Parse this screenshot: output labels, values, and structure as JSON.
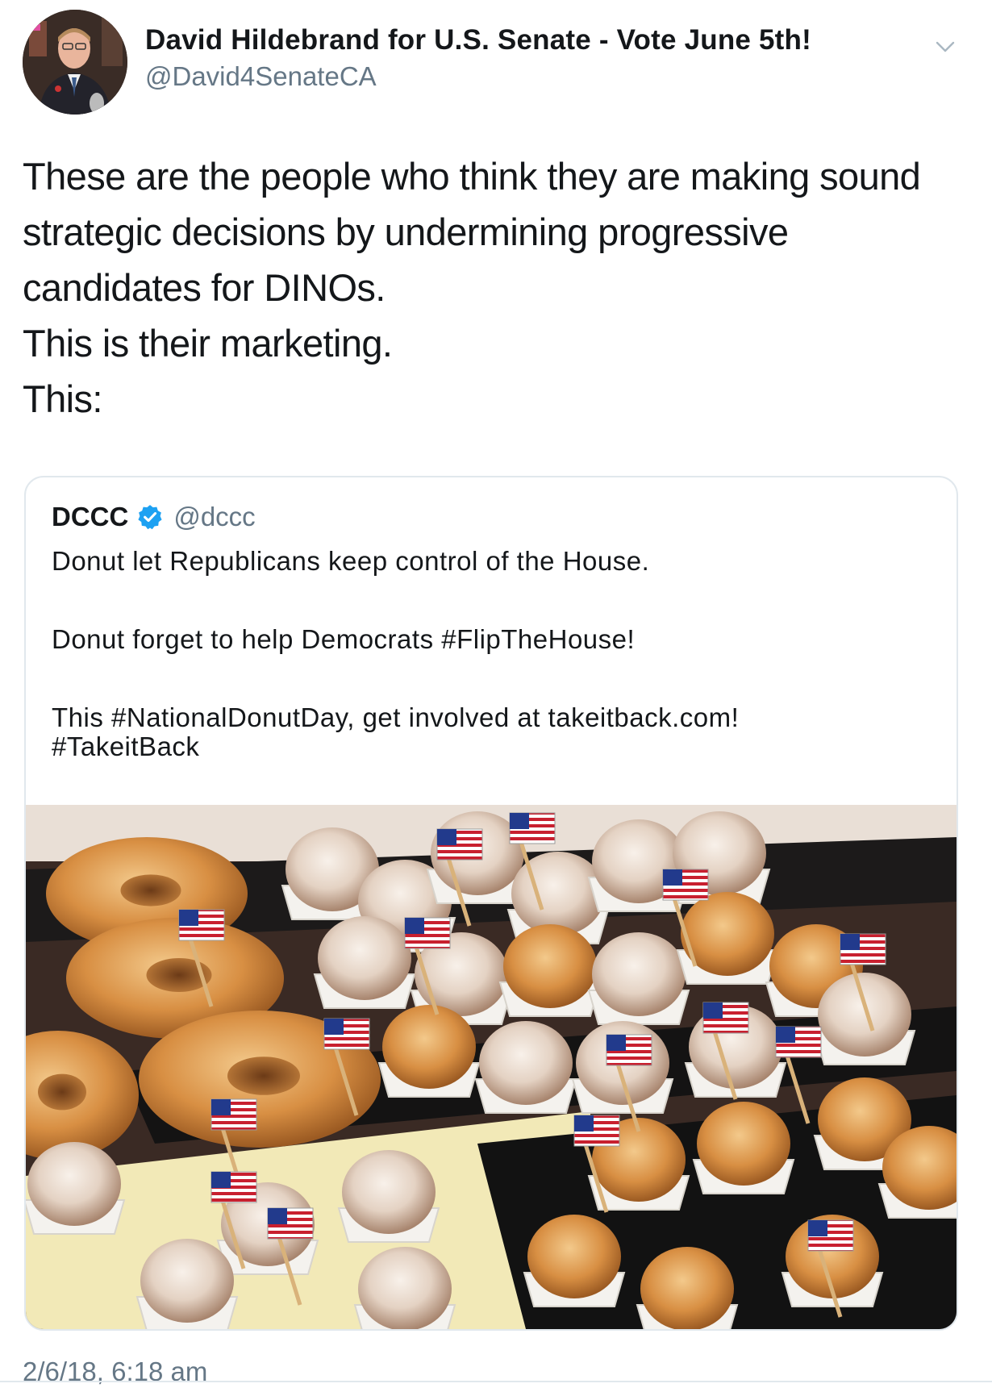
{
  "tweet": {
    "display_name": "David Hildebrand for U.S. Senate - Vote June 5th!",
    "handle": "@David4SenateCA",
    "avatar_icon": "profile-photo",
    "text_lines": [
      "These are the people who think they are making sound",
      "strategic decisions by undermining progressive",
      "candidates for DINOs.",
      "This is their marketing.",
      "This:"
    ],
    "timestamp": "2/6/18, 6:18 am"
  },
  "quoted_tweet": {
    "name": "DCCC",
    "verified": true,
    "handle": "@dccc",
    "paragraphs": [
      [
        "Donut let Republicans keep control of the House."
      ],
      [
        "Donut forget to help Democrats #FlipTheHouse!"
      ],
      [
        "This #NationalDonutDay, get involved at takeitback.com!",
        "#TakeitBack"
      ]
    ],
    "image_icon": "donuts-with-flags-photo"
  },
  "colors": {
    "text": "#14171a",
    "secondary": "#657786",
    "verified_blue": "#1da1f2",
    "border": "#e1e8ed"
  }
}
